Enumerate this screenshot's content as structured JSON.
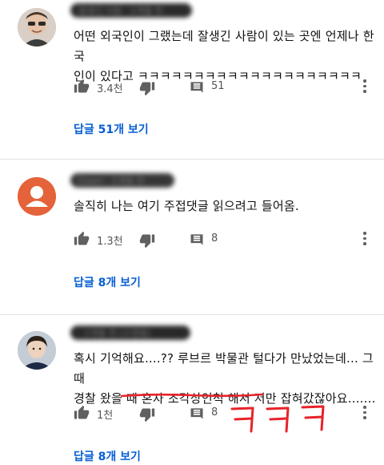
{
  "comments": [
    {
      "header": "잘생긴 사람 · 1개월 전",
      "text_lines": [
        "어떤 외국인이 그랬는데 잘생긴 사람이 있는 곳엔 언제나 한국",
        "인이 있다고 ㅋㅋㅋㅋㅋㅋㅋㅋㅋㅋㅋㅋㅋㅋㅋㅋㅋㅋㅋㅋ"
      ],
      "likes": "3.4천",
      "replies_count": "51",
      "replies_prefix": "답글 ",
      "replies_num": "51개",
      "replies_suffix": " 보기"
    },
    {
      "header": "Dawn · 1개월 전",
      "text_lines": [
        "솔직히 나는 여기 주접댓글 읽으려고 들어옴."
      ],
      "likes": "1.3천",
      "replies_count": "8",
      "replies_prefix": "답글 ",
      "replies_num": "8개",
      "replies_suffix": " 보기"
    },
    {
      "header": "· 1개월 전 (수정됨)",
      "text_line1": "혹시 기억해요....?? 루브르 박물관 털다가 만났었는데... 그 때",
      "text_line2_pre": "경찰 왔을 때 ",
      "text_line2_hl": "혼자 조각상인척 해서",
      "text_line2_post": " 저만 잡혀갔잖아요.......",
      "likes": "1천",
      "replies_count": "8",
      "replies_prefix": "답글 ",
      "replies_num": "8개",
      "replies_suffix": " 보기",
      "handwritten": "ㅋㅋㅋ"
    }
  ],
  "colors": {
    "reply_link": "#065fd4",
    "annotation": "#e8232a",
    "avatar_orange": "#e5633a"
  }
}
